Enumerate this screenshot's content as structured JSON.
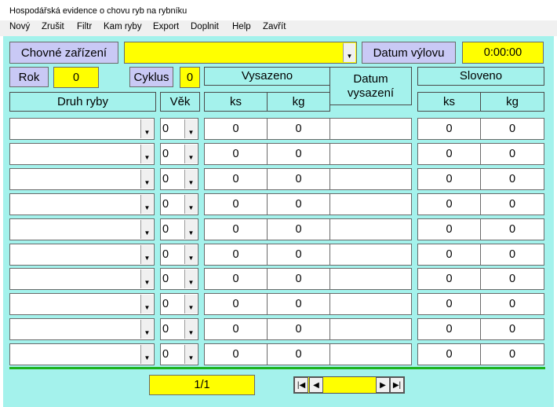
{
  "window": {
    "title": "Hospodářská evidence o chovu ryb na rybníku"
  },
  "menu": [
    "Nový",
    "Zrušit",
    "Filtr",
    "Kam ryby",
    "Export",
    "Doplnit",
    "Help",
    "Zavřít"
  ],
  "header": {
    "chovne_zarizeni_label": "Chovné zařízení",
    "chovne_zarizeni_value": "",
    "datum_vylovu_label": "Datum výlovu",
    "datum_vylovu_value": "0:00:00",
    "rok_label": "Rok",
    "rok_value": "0",
    "cyklus_label": "Cyklus",
    "cyklus_value": "0"
  },
  "columns": {
    "vysazeno": "Vysazeno",
    "datum_vysazeni": "Datum vysazení",
    "sloveno": "Sloveno",
    "druh_ryby": "Druh ryby",
    "vek": "Věk",
    "ks": "ks",
    "kg": "kg"
  },
  "rows": [
    {
      "druh": "",
      "vek": "0",
      "vys_ks": "0",
      "vys_kg": "0",
      "datum": "",
      "slov_ks": "0",
      "slov_kg": "0"
    },
    {
      "druh": "",
      "vek": "0",
      "vys_ks": "0",
      "vys_kg": "0",
      "datum": "",
      "slov_ks": "0",
      "slov_kg": "0"
    },
    {
      "druh": "",
      "vek": "0",
      "vys_ks": "0",
      "vys_kg": "0",
      "datum": "",
      "slov_ks": "0",
      "slov_kg": "0"
    },
    {
      "druh": "",
      "vek": "0",
      "vys_ks": "0",
      "vys_kg": "0",
      "datum": "",
      "slov_ks": "0",
      "slov_kg": "0"
    },
    {
      "druh": "",
      "vek": "0",
      "vys_ks": "0",
      "vys_kg": "0",
      "datum": "",
      "slov_ks": "0",
      "slov_kg": "0"
    },
    {
      "druh": "",
      "vek": "0",
      "vys_ks": "0",
      "vys_kg": "0",
      "datum": "",
      "slov_ks": "0",
      "slov_kg": "0"
    },
    {
      "druh": "",
      "vek": "0",
      "vys_ks": "0",
      "vys_kg": "0",
      "datum": "",
      "slov_ks": "0",
      "slov_kg": "0"
    },
    {
      "druh": "",
      "vek": "0",
      "vys_ks": "0",
      "vys_kg": "0",
      "datum": "",
      "slov_ks": "0",
      "slov_kg": "0"
    },
    {
      "druh": "",
      "vek": "0",
      "vys_ks": "0",
      "vys_kg": "0",
      "datum": "",
      "slov_ks": "0",
      "slov_kg": "0"
    },
    {
      "druh": "",
      "vek": "0",
      "vys_ks": "0",
      "vys_kg": "0",
      "datum": "",
      "slov_ks": "0",
      "slov_kg": "0"
    }
  ],
  "footer": {
    "page_indicator": "1/1",
    "nav_icons": [
      "first-record-icon",
      "previous-record-icon",
      "next-record-icon",
      "last-record-icon"
    ]
  },
  "colors": {
    "form_background": "#a4f2ec",
    "label_button": "#c9c9f5",
    "value_highlight": "#ffff00",
    "separator_line": "#1db31d"
  }
}
